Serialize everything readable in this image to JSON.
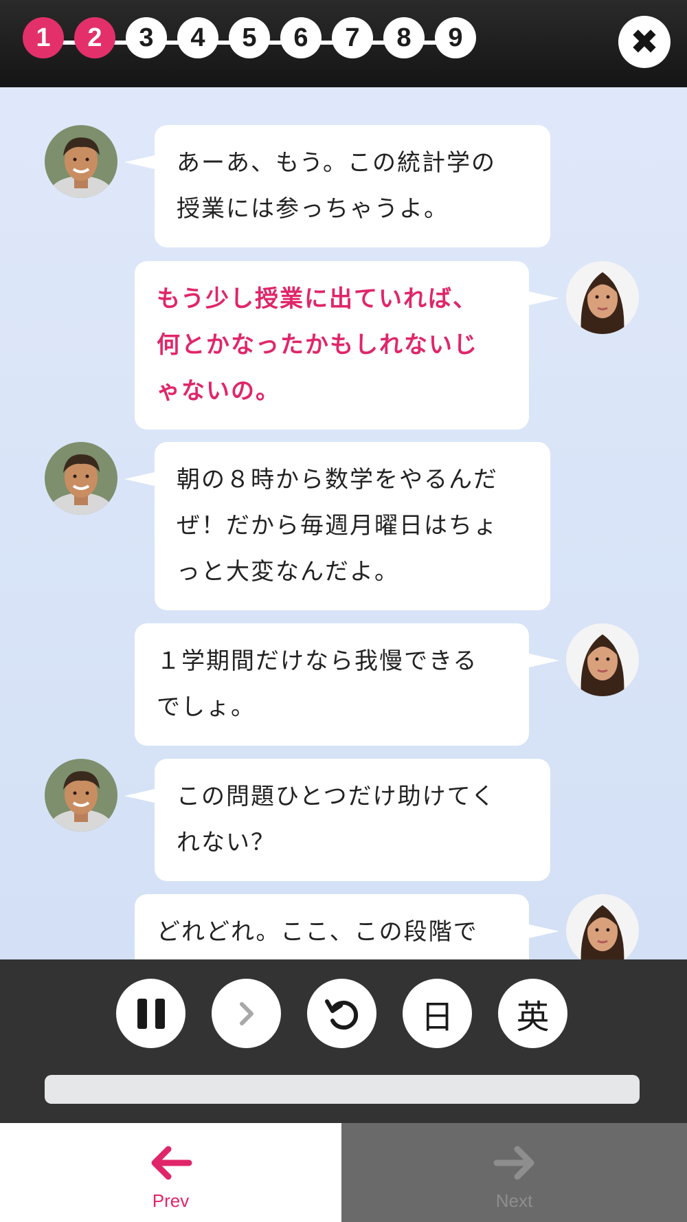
{
  "steps": [
    {
      "label": "1",
      "done": true
    },
    {
      "label": "2",
      "done": true
    },
    {
      "label": "3",
      "done": false
    },
    {
      "label": "4",
      "done": false
    },
    {
      "label": "5",
      "done": false
    },
    {
      "label": "6",
      "done": false
    },
    {
      "label": "7",
      "done": false
    },
    {
      "label": "8",
      "done": false
    },
    {
      "label": "9",
      "done": false
    }
  ],
  "close_icon": "close-icon",
  "colors": {
    "accent": "#e3306a",
    "topbar": "#1a1a1a",
    "chat_background": "#dbe6f8",
    "controls_background": "#333333",
    "next_background": "#6a6a6a"
  },
  "messages": [
    {
      "speaker": "male",
      "side": "left",
      "highlighted": false,
      "lines": [
        "あーあ、もう。この統計学の",
        "授業には参っちゃうよ。"
      ]
    },
    {
      "speaker": "female",
      "side": "right",
      "highlighted": true,
      "lines": [
        "もう少し授業に出ていれば、",
        "何とかなったかもしれないじ",
        "ゃないの。"
      ]
    },
    {
      "speaker": "male",
      "side": "left",
      "highlighted": false,
      "lines": [
        "朝の８時から数学をやるんだ",
        "ぜ！だから毎週月曜日はちょ",
        "っと大変なんだよ。"
      ]
    },
    {
      "speaker": "female",
      "side": "right",
      "highlighted": false,
      "lines": [
        "１学期間だけなら我慢できる",
        "でしょ。"
      ]
    },
    {
      "speaker": "male",
      "side": "left",
      "highlighted": false,
      "lines": [
        "この問題ひとつだけ助けてく",
        "れない？"
      ]
    },
    {
      "speaker": "female",
      "side": "right",
      "highlighted": false,
      "lines": [
        "どれどれ。ここ、この段階で"
      ]
    }
  ],
  "controls": {
    "pause_icon": "pause-icon",
    "forward_icon": "chevron-right-icon",
    "replay_icon": "replay-icon",
    "japanese_label": "日",
    "english_label": "英",
    "progress": 0.0
  },
  "nav": {
    "prev_label": "Prev",
    "next_label": "Next",
    "prev_icon": "arrow-left-icon",
    "next_icon": "arrow-right-icon"
  }
}
